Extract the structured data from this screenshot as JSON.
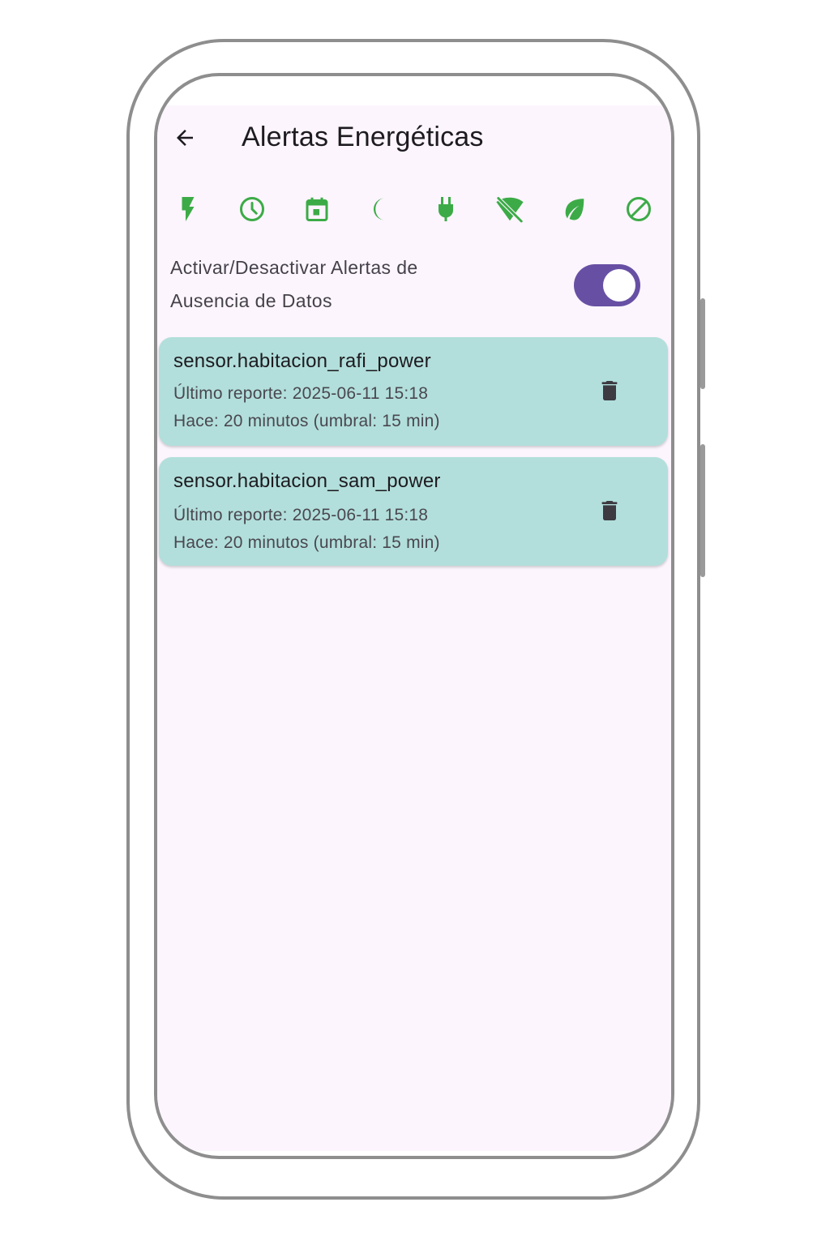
{
  "app": {
    "title": "Alertas Energéticas"
  },
  "theme": {
    "background": "#fcf5fd",
    "accent_green": "#3cab47",
    "switch_track": "#6750a4",
    "card_background": "#b2dfdb",
    "text_dark": "#1d1b20"
  },
  "filter_icons": [
    "bolt-icon",
    "clock-icon",
    "calendar-icon",
    "moon-icon",
    "plug-icon",
    "wifi-off-icon",
    "leaf-icon",
    "block-icon"
  ],
  "toggle": {
    "label": "Activar/Desactivar Alertas de Ausencia de Datos",
    "state": "on"
  },
  "alerts": [
    {
      "sensor": "sensor.habitacion_rafi_power",
      "last_report": "Último reporte: 2025-06-11 15:18",
      "elapsed": "Hace: 20 minutos (umbral: 15 min)"
    },
    {
      "sensor": "sensor.habitacion_sam_power",
      "last_report": "Último reporte: 2025-06-11 15:18",
      "elapsed": "Hace: 20 minutos (umbral: 15 min)"
    }
  ]
}
